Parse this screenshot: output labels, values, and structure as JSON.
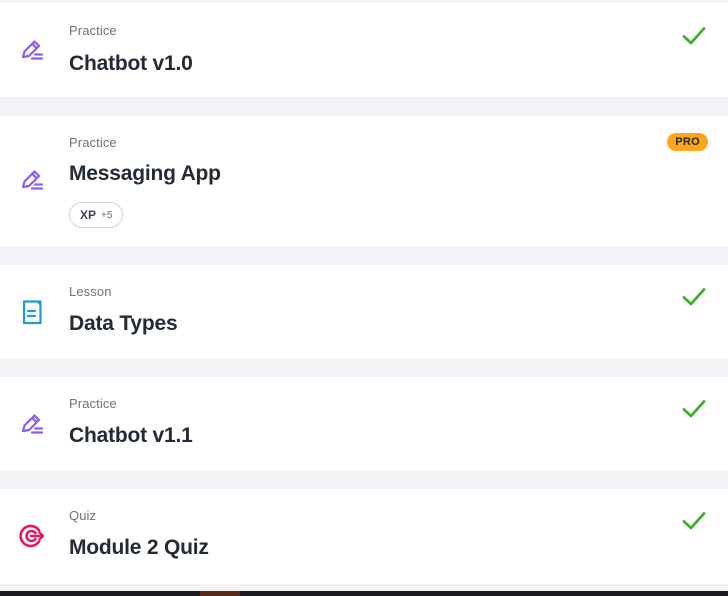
{
  "colors": {
    "practice_icon": "#8a5cf5",
    "lesson_icon": "#1e9bd7",
    "quiz_icon": "#e8185d",
    "check": "#3fae2a",
    "pro_badge": "#ffa41b"
  },
  "items": [
    {
      "kind": "Practice",
      "title": "Chatbot v1.0",
      "icon": "pencil-icon",
      "status": "completed"
    },
    {
      "kind": "Practice",
      "title": "Messaging App",
      "icon": "pencil-icon",
      "badge": "PRO",
      "xp_label": "XP",
      "xp_value": "+5"
    },
    {
      "kind": "Lesson",
      "title": "Data Types",
      "icon": "document-icon",
      "status": "completed"
    },
    {
      "kind": "Practice",
      "title": "Chatbot v1.1",
      "icon": "pencil-icon",
      "status": "completed"
    },
    {
      "kind": "Quiz",
      "title": "Module 2 Quiz",
      "icon": "target-icon",
      "status": "completed"
    }
  ]
}
